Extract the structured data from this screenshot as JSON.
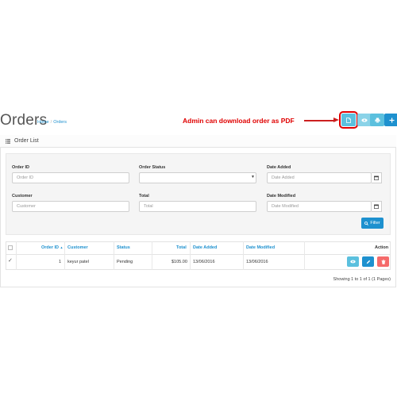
{
  "header": {
    "title": "Orders",
    "breadcrumb": {
      "home": "Home",
      "separator": "/",
      "current": "Orders"
    },
    "annotation": "Admin can download order as PDF",
    "buttons": [
      {
        "icon": "file-icon"
      },
      {
        "icon": "eye-icon"
      },
      {
        "icon": "print-icon"
      },
      {
        "icon": "plus-icon"
      }
    ]
  },
  "panel": {
    "title": "Order List",
    "icon": "list-icon"
  },
  "filters": {
    "order_id": {
      "label": "Order ID",
      "placeholder": "Order ID",
      "value": ""
    },
    "order_status": {
      "label": "Order Status",
      "value": ""
    },
    "date_added": {
      "label": "Date Added",
      "placeholder": "Date Added",
      "value": ""
    },
    "customer": {
      "label": "Customer",
      "placeholder": "Customer",
      "value": ""
    },
    "total": {
      "label": "Total",
      "placeholder": "Total",
      "value": ""
    },
    "date_modified": {
      "label": "Date Modified",
      "placeholder": "Date Modified",
      "value": ""
    },
    "filter_button": "Filter"
  },
  "table": {
    "headers": {
      "order_id": "Order ID",
      "sort_indicator": "▲",
      "customer": "Customer",
      "status": "Status",
      "total": "Total",
      "date_added": "Date Added",
      "date_modified": "Date Modified",
      "action": "Action"
    },
    "rows": [
      {
        "checked": true,
        "order_id": "1",
        "customer": "keyur patel",
        "status": "Pending",
        "total": "$105.00",
        "date_added": "13/06/2016",
        "date_modified": "13/06/2016",
        "actions": [
          "eye-icon",
          "pencil-icon",
          "trash-icon"
        ]
      }
    ]
  },
  "pagination": {
    "showing": "Showing 1 to 1 of 1 (1 Pages)"
  },
  "colors": {
    "primary": "#1e91cf",
    "info": "#5bc0de",
    "danger": "#f56b6b",
    "annotation": "#e00000"
  }
}
